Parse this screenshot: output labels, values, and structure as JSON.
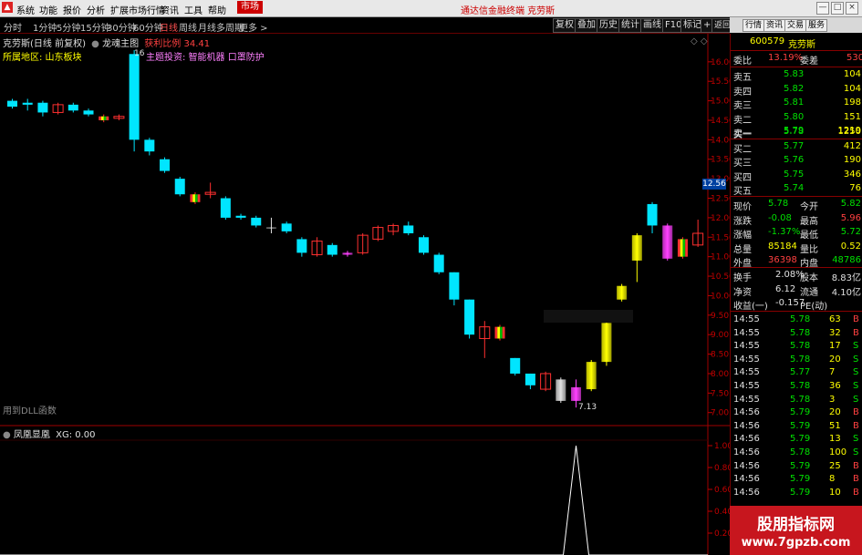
{
  "menu": {
    "items": [
      "系统",
      "功能",
      "报价",
      "分析",
      "扩展市场行情",
      "资讯",
      "工具",
      "帮助"
    ],
    "market": "市场",
    "center_title": "通达信金融终端  克劳斯",
    "win_buttons": [
      "—",
      "□",
      "×"
    ]
  },
  "toolbar": {
    "periods": [
      "分时",
      "1分钟",
      "5分钟",
      "15分钟",
      "30分钟",
      "60分钟",
      "日线",
      "周线",
      "月线",
      "多周期",
      "更多 >"
    ],
    "active": "日线",
    "right_buttons": [
      "复权",
      "叠加",
      "历史",
      "统计",
      "画线",
      "F10",
      "标记",
      "+自选",
      "返回"
    ]
  },
  "right_tabs": [
    "行情",
    "资讯",
    "交易",
    "服务"
  ],
  "chart_header": {
    "name": "克劳斯(日线 前复权)",
    "indicator": "龙魂主图",
    "ratio_label": "获利比例",
    "ratio_value": "34.41",
    "region": "所属地区: 山东板块",
    "theme": "主题投资: 智能机器 口罩防护",
    "max_label": "16",
    "min_label": "7.13",
    "dll_note": "用到DLL函数"
  },
  "sub_header": {
    "name": "凤凰显凰",
    "xg": "XG: 0.00"
  },
  "price_axis": [
    "16.00",
    "15.50",
    "15.00",
    "14.50",
    "14.00",
    "13.50",
    "13.00",
    "12.50",
    "12.00",
    "11.50",
    "11.00",
    "10.50",
    "10.00",
    "9.50",
    "9.00",
    "8.50",
    "8.00",
    "7.50",
    "7.00"
  ],
  "price_marker": "12.56",
  "sub_axis": [
    "1.00",
    "0.80",
    "0.60",
    "0.40",
    "0.20"
  ],
  "chart_data": {
    "type": "candlestick",
    "price_range": [
      6.9,
      16.3
    ],
    "sub_range": [
      0,
      1.1
    ],
    "candles": [
      {
        "o": 14.85,
        "c": 15.0,
        "h": 15.05,
        "l": 14.8,
        "col": "cyan"
      },
      {
        "o": 14.9,
        "c": 14.95,
        "h": 15.05,
        "l": 14.75,
        "col": "cyan"
      },
      {
        "o": 14.95,
        "c": 14.7,
        "h": 15.0,
        "l": 14.6,
        "col": "cyan"
      },
      {
        "o": 14.7,
        "c": 14.9,
        "h": 14.95,
        "l": 14.65,
        "col": "red"
      },
      {
        "o": 14.9,
        "c": 14.75,
        "h": 14.95,
        "l": 14.7,
        "col": "cyan"
      },
      {
        "o": 14.75,
        "c": 14.65,
        "h": 14.8,
        "l": 14.6,
        "col": "cyan"
      },
      {
        "o": 14.6,
        "c": 14.5,
        "h": 14.65,
        "l": 14.45,
        "col": "multi"
      },
      {
        "o": 14.55,
        "c": 14.6,
        "h": 14.65,
        "l": 14.5,
        "col": "red"
      },
      {
        "o": 16.2,
        "c": 14.0,
        "h": 16.3,
        "l": 13.7,
        "col": "cyan"
      },
      {
        "o": 14.0,
        "c": 13.7,
        "h": 14.05,
        "l": 13.6,
        "col": "cyan"
      },
      {
        "o": 13.5,
        "c": 13.2,
        "h": 13.55,
        "l": 13.15,
        "col": "cyan"
      },
      {
        "o": 13.0,
        "c": 12.6,
        "h": 13.05,
        "l": 12.55,
        "col": "cyan"
      },
      {
        "o": 12.4,
        "c": 12.6,
        "h": 12.65,
        "l": 12.35,
        "col": "multi"
      },
      {
        "o": 12.6,
        "c": 12.65,
        "h": 12.9,
        "l": 12.5,
        "col": "red"
      },
      {
        "o": 12.5,
        "c": 12.0,
        "h": 12.55,
        "l": 11.95,
        "col": "cyan"
      },
      {
        "o": 12.05,
        "c": 12.0,
        "h": 12.1,
        "l": 11.95,
        "col": "cyan"
      },
      {
        "o": 12.0,
        "c": 11.8,
        "h": 12.05,
        "l": 11.75,
        "col": "cyan"
      },
      {
        "o": 11.75,
        "c": 11.75,
        "h": 12.0,
        "l": 11.6,
        "col": "white"
      },
      {
        "o": 11.85,
        "c": 11.65,
        "h": 11.9,
        "l": 11.6,
        "col": "cyan"
      },
      {
        "o": 11.45,
        "c": 11.1,
        "h": 11.5,
        "l": 11.0,
        "col": "cyan"
      },
      {
        "o": 11.05,
        "c": 11.4,
        "h": 11.5,
        "l": 11.0,
        "col": "red"
      },
      {
        "o": 11.3,
        "c": 11.05,
        "h": 11.35,
        "l": 11.0,
        "col": "cyan"
      },
      {
        "o": 11.1,
        "c": 11.05,
        "h": 11.15,
        "l": 11.0,
        "col": "magenta"
      },
      {
        "o": 11.1,
        "c": 11.55,
        "h": 11.6,
        "l": 11.05,
        "col": "red"
      },
      {
        "o": 11.45,
        "c": 11.75,
        "h": 11.8,
        "l": 11.4,
        "col": "red"
      },
      {
        "o": 11.65,
        "c": 11.8,
        "h": 11.85,
        "l": 11.55,
        "col": "red"
      },
      {
        "o": 11.8,
        "c": 11.6,
        "h": 11.9,
        "l": 11.55,
        "col": "cyan"
      },
      {
        "o": 11.5,
        "c": 11.1,
        "h": 11.55,
        "l": 11.05,
        "col": "cyan"
      },
      {
        "o": 11.05,
        "c": 10.6,
        "h": 11.1,
        "l": 10.55,
        "col": "cyan"
      },
      {
        "o": 10.6,
        "c": 9.9,
        "h": 10.6,
        "l": 9.75,
        "col": "cyan"
      },
      {
        "o": 9.9,
        "c": 9.0,
        "h": 9.9,
        "l": 8.9,
        "col": "cyan"
      },
      {
        "o": 8.9,
        "c": 9.2,
        "h": 9.35,
        "l": 8.4,
        "col": "red"
      },
      {
        "o": 9.2,
        "c": 8.9,
        "h": 9.25,
        "l": 8.85,
        "col": "multi"
      },
      {
        "o": 8.4,
        "c": 8.0,
        "h": 8.4,
        "l": 7.95,
        "col": "cyan"
      },
      {
        "o": 8.0,
        "c": 7.7,
        "h": 8.0,
        "l": 7.6,
        "col": "cyan"
      },
      {
        "o": 7.6,
        "c": 8.0,
        "h": 8.05,
        "l": 7.55,
        "col": "red"
      },
      {
        "o": 7.85,
        "c": 7.3,
        "h": 7.9,
        "l": 7.25,
        "col": "white"
      },
      {
        "o": 7.3,
        "c": 7.65,
        "h": 7.85,
        "l": 7.13,
        "col": "magenta"
      },
      {
        "o": 7.6,
        "c": 8.3,
        "h": 8.35,
        "l": 7.55,
        "col": "yellow"
      },
      {
        "o": 8.3,
        "c": 9.3,
        "h": 9.35,
        "l": 8.2,
        "col": "yellow"
      },
      {
        "o": 9.9,
        "c": 10.25,
        "h": 10.3,
        "l": 9.85,
        "col": "yellow"
      },
      {
        "o": 10.9,
        "c": 11.55,
        "h": 11.6,
        "l": 10.35,
        "col": "yellow"
      },
      {
        "o": 12.35,
        "c": 11.8,
        "h": 12.4,
        "l": 11.6,
        "col": "cyan"
      },
      {
        "o": 11.8,
        "c": 10.95,
        "h": 11.85,
        "l": 10.9,
        "col": "magenta"
      },
      {
        "o": 11.45,
        "c": 11.0,
        "h": 11.5,
        "l": 10.95,
        "col": "multi"
      },
      {
        "o": 11.3,
        "c": 11.6,
        "h": 11.95,
        "l": 11.25,
        "col": "red"
      }
    ],
    "signal": [
      {
        "i": 37,
        "v": 1.0
      }
    ]
  },
  "quote": {
    "code": "600579",
    "name": "克劳斯",
    "webi_label": "委比",
    "webi": "13.19%",
    "wecha_label": "委差",
    "wecha": "530",
    "asks": [
      {
        "label": "卖五",
        "price": "5.83",
        "vol": "104"
      },
      {
        "label": "卖四",
        "price": "5.82",
        "vol": "104"
      },
      {
        "label": "卖三",
        "price": "5.81",
        "vol": "198"
      },
      {
        "label": "卖二",
        "price": "5.80",
        "vol": "151"
      },
      {
        "label": "卖一",
        "price": "5.79",
        "vol": "1219"
      }
    ],
    "bids": [
      {
        "label": "买一",
        "price": "5.78",
        "vol": "1250"
      },
      {
        "label": "买二",
        "price": "5.77",
        "vol": "412"
      },
      {
        "label": "买三",
        "price": "5.76",
        "vol": "190"
      },
      {
        "label": "买四",
        "price": "5.75",
        "vol": "346"
      },
      {
        "label": "买五",
        "price": "5.74",
        "vol": "76"
      }
    ],
    "stats": [
      {
        "l1": "现价",
        "v1": "5.78",
        "c1": "green",
        "l2": "今开",
        "v2": "5.82",
        "c2": "green"
      },
      {
        "l1": "涨跌",
        "v1": "-0.08",
        "c1": "green",
        "l2": "最高",
        "v2": "5.96",
        "c2": "red"
      },
      {
        "l1": "涨幅",
        "v1": "-1.37%",
        "c1": "green",
        "l2": "最低",
        "v2": "5.72",
        "c2": "green"
      },
      {
        "l1": "总量",
        "v1": "85184",
        "c1": "yellow",
        "l2": "量比",
        "v2": "0.52",
        "c2": "yellow"
      },
      {
        "l1": "外盘",
        "v1": "36398",
        "c1": "red",
        "l2": "内盘",
        "v2": "48786",
        "c2": "green"
      }
    ],
    "stats2": [
      {
        "l1": "换手",
        "v1": "2.08%",
        "l2": "股本",
        "v2": "8.83亿"
      },
      {
        "l1": "净资",
        "v1": "6.12",
        "l2": "流通",
        "v2": "4.10亿"
      },
      {
        "l1": "收益(一)",
        "v1": "-0.157",
        "l2": "PE(动)",
        "v2": ""
      }
    ],
    "ticks": [
      {
        "t": "14:55",
        "p": "5.78",
        "v": "63",
        "s": "B"
      },
      {
        "t": "14:55",
        "p": "5.78",
        "v": "32",
        "s": "B"
      },
      {
        "t": "14:55",
        "p": "5.78",
        "v": "17",
        "s": "S"
      },
      {
        "t": "14:55",
        "p": "5.78",
        "v": "20",
        "s": "S"
      },
      {
        "t": "14:55",
        "p": "5.77",
        "v": "7",
        "s": "S"
      },
      {
        "t": "14:55",
        "p": "5.78",
        "v": "36",
        "s": "S"
      },
      {
        "t": "14:55",
        "p": "5.78",
        "v": "3",
        "s": "S"
      },
      {
        "t": "14:56",
        "p": "5.79",
        "v": "20",
        "s": "B"
      },
      {
        "t": "14:56",
        "p": "5.79",
        "v": "51",
        "s": "B"
      },
      {
        "t": "14:56",
        "p": "5.79",
        "v": "13",
        "s": "S"
      },
      {
        "t": "14:56",
        "p": "5.78",
        "v": "100",
        "s": "S"
      },
      {
        "t": "14:56",
        "p": "5.79",
        "v": "25",
        "s": "B"
      },
      {
        "t": "14:56",
        "p": "5.79",
        "v": "8",
        "s": "B"
      },
      {
        "t": "14:56",
        "p": "5.79",
        "v": "10",
        "s": "B"
      }
    ]
  },
  "watermark": {
    "line1": "股朋指标网",
    "line2": "www.7gpzb.com"
  }
}
